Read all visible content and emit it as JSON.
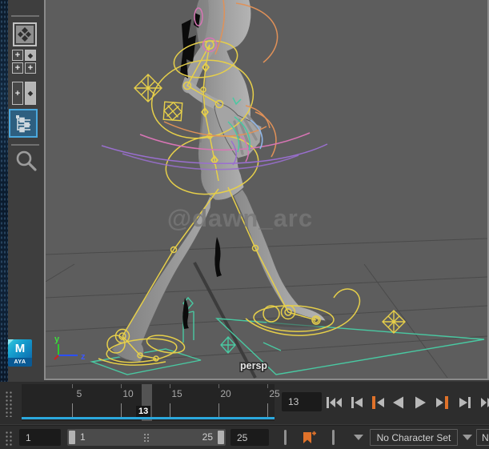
{
  "icons": {
    "plus": "+",
    "diamond": "◆"
  },
  "maya_badge": {
    "letter": "M",
    "caption": "AYA"
  },
  "viewport": {
    "camera_label": "persp",
    "watermark": "@dawn_arc",
    "axis_y_label": "y",
    "axis_z_label": "z"
  },
  "timeline": {
    "ticks": [
      "5",
      "10",
      "15",
      "20",
      "25"
    ],
    "current_frame": "13",
    "current_frame_field": "13"
  },
  "range": {
    "start_field": "1",
    "slider_start_label": "1",
    "slider_end_label": "25",
    "end_field": "25",
    "character_set": "No Character Set",
    "anim_layer_partial": "N"
  },
  "colors": {
    "viewport_grey": "#5d5d5d",
    "timeline_cyan": "#2ba8dd",
    "key_orange": "#e0722a",
    "rig_yellow": "#e6cf4a",
    "control_teal": "#49c9a2",
    "active_button_blue": "#4aa8dd"
  }
}
